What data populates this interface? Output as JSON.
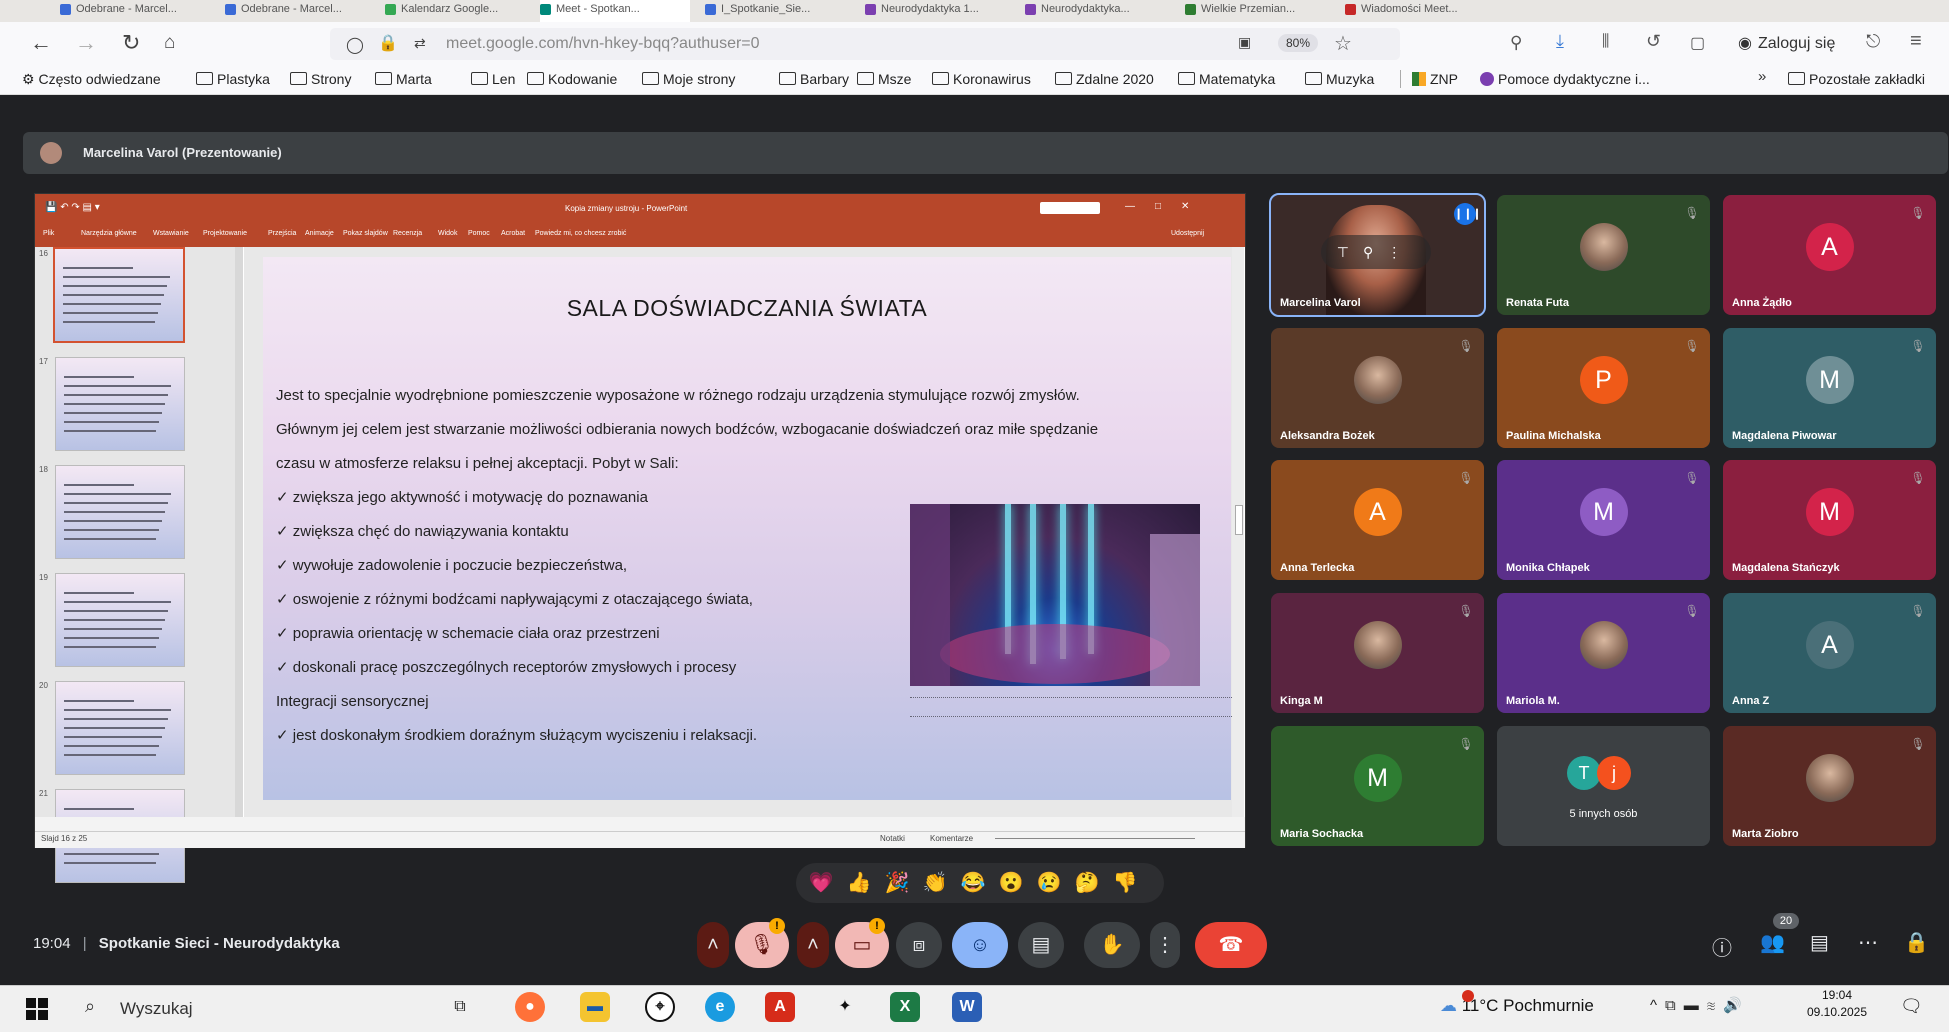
{
  "browser": {
    "tabs": [
      "Odebrane - Marcel...",
      "Odebrane - Marcel...",
      "Kalendarz Google...",
      "Meet - Spotkan...",
      "I_Spotkanie_Sie...",
      "Neurodydaktyka 1...",
      "Neurodydaktyka...",
      "Wielkie Przemian...",
      "Wiadomości Meet..."
    ],
    "url": "meet.google.com/hvn-hkey-bqq?authuser=0",
    "zoom": "80%",
    "login": "Zaloguj się",
    "bookmarks": [
      "Często odwiedzane",
      "Plastyka",
      "Strony",
      "Marta",
      "Len",
      "Kodowanie",
      "Moje strony",
      "Barbary",
      "Msze",
      "Koronawirus",
      "Zdalne 2020",
      "Matematyka",
      "Muzyka",
      "ZNP",
      "Pomoce dydaktyczne i...",
      "Pozostałe zakładki"
    ]
  },
  "meet": {
    "presenter_label": "Marcelina Varol (Prezentowanie)",
    "time": "19:04",
    "meeting_name": "Spotkanie Sieci - Neurodydaktyka",
    "participant_count": "20",
    "participants": [
      {
        "name": "Marcelina Varol",
        "type": "photo",
        "color": "#3a2a28"
      },
      {
        "name": "Renata Futa",
        "type": "photo",
        "color": "#2e4a2a"
      },
      {
        "name": "Anna Żądło",
        "type": "letter",
        "letter": "A",
        "color": "#8b1f3f",
        "avatar_color": "#d3234a"
      },
      {
        "name": "Aleksandra Bożek",
        "type": "photo",
        "color": "#5a3a28"
      },
      {
        "name": "Paulina Michalska",
        "type": "letter",
        "letter": "P",
        "color": "#8a4a1e",
        "avatar_color": "#f05a18"
      },
      {
        "name": "Magdalena Piwowar",
        "type": "letter",
        "letter": "M",
        "color": "#2f5d66",
        "avatar_color": "#6f8f96"
      },
      {
        "name": "Anna Terlecka",
        "type": "letter",
        "letter": "A",
        "color": "#8a4a1e",
        "avatar_color": "#f07a18"
      },
      {
        "name": "Monika Chłapek",
        "type": "letter",
        "letter": "M",
        "color": "#5b2f8a",
        "avatar_color": "#8e5cc4"
      },
      {
        "name": "Magdalena Stańczyk",
        "type": "letter",
        "letter": "M",
        "color": "#8b1f3f",
        "avatar_color": "#d3234a"
      },
      {
        "name": "Kinga M",
        "type": "photo",
        "color": "#5a2440"
      },
      {
        "name": "Mariola M.",
        "type": "photo",
        "color": "#5b2f8a"
      },
      {
        "name": "Anna Z",
        "type": "letter",
        "letter": "A",
        "color": "#2f5d66",
        "avatar_color": "#4a6f78"
      },
      {
        "name": "Maria Sochacka",
        "type": "letter",
        "letter": "M",
        "color": "#2e5a2a",
        "avatar_color": "#2e7d32"
      },
      {
        "name": "5 innych osób",
        "type": "others",
        "color": "#3c4043"
      },
      {
        "name": "Marta Ziobro",
        "type": "photo",
        "color": "#5a2a24"
      }
    ],
    "reactions": [
      "💗",
      "👍",
      "🎉",
      "👏",
      "😂",
      "😮",
      "😢",
      "🤔",
      "👎"
    ]
  },
  "slide": {
    "window_title": "Kopia zmiany ustroju - PowerPoint",
    "ribbon": [
      "Plik",
      "Narzędzia główne",
      "Wstawianie",
      "Projektowanie",
      "Przejścia",
      "Animacje",
      "Pokaz slajdów",
      "Recenzja",
      "Widok",
      "Pomoc",
      "Acrobat",
      "Powiedz mi, co chcesz zrobić",
      "Udostępnij"
    ],
    "thumb_numbers": [
      "16",
      "17",
      "18",
      "19",
      "20",
      "21"
    ],
    "title": "SALA DOŚWIADCZANIA ŚWIATA",
    "intro_lines": [
      "Jest to specjalnie wyodrębnione pomieszczenie wyposażone w różnego rodzaju urządzenia stymulujące rozwój zmysłów.",
      "Głównym jej celem jest stwarzanie możliwości odbierania nowych bodźców, wzbogacanie doświadczeń oraz miłe spędzanie",
      "czasu w atmosferze relaksu i pełnej akceptacji. Pobyt w Sali:"
    ],
    "bullets": [
      "zwiększa jego aktywność i motywację do poznawania",
      "zwiększa chęć do nawiązywania kontaktu",
      "wywołuje zadowolenie i poczucie bezpieczeństwa,",
      "oswojenie z różnymi bodźcami napływającymi z otaczającego świata,",
      "poprawia orientację w schemacie ciała oraz przestrzeni",
      "doskonali pracę poszczególnych receptorów zmysłowych i procesy"
    ],
    "continuation": "Integracji sensorycznej",
    "last_bullet": "jest doskonałym środkiem doraźnym służącym wyciszeniu i relaksacji.",
    "statusbar_left": "Slajd 16 z 25",
    "statusbar_notes": "Notatki",
    "statusbar_comments": "Komentarze"
  },
  "taskbar": {
    "search": "Wyszukaj",
    "weather": "11°C  Pochmurnie",
    "clock_time": "19:04",
    "clock_date": "09.10.2025"
  }
}
